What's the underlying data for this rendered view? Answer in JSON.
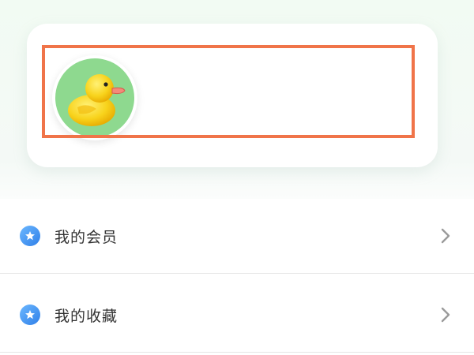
{
  "menu": {
    "items": [
      {
        "label": "我的会员",
        "icon": "star-badge-icon"
      },
      {
        "label": "我的收藏",
        "icon": "star-badge-icon"
      }
    ]
  },
  "colors": {
    "highlight": "#f07449",
    "icon_blue": "#3d8ff0",
    "avatar_bg": "#8ed98f",
    "duck": "#f6d31a"
  }
}
